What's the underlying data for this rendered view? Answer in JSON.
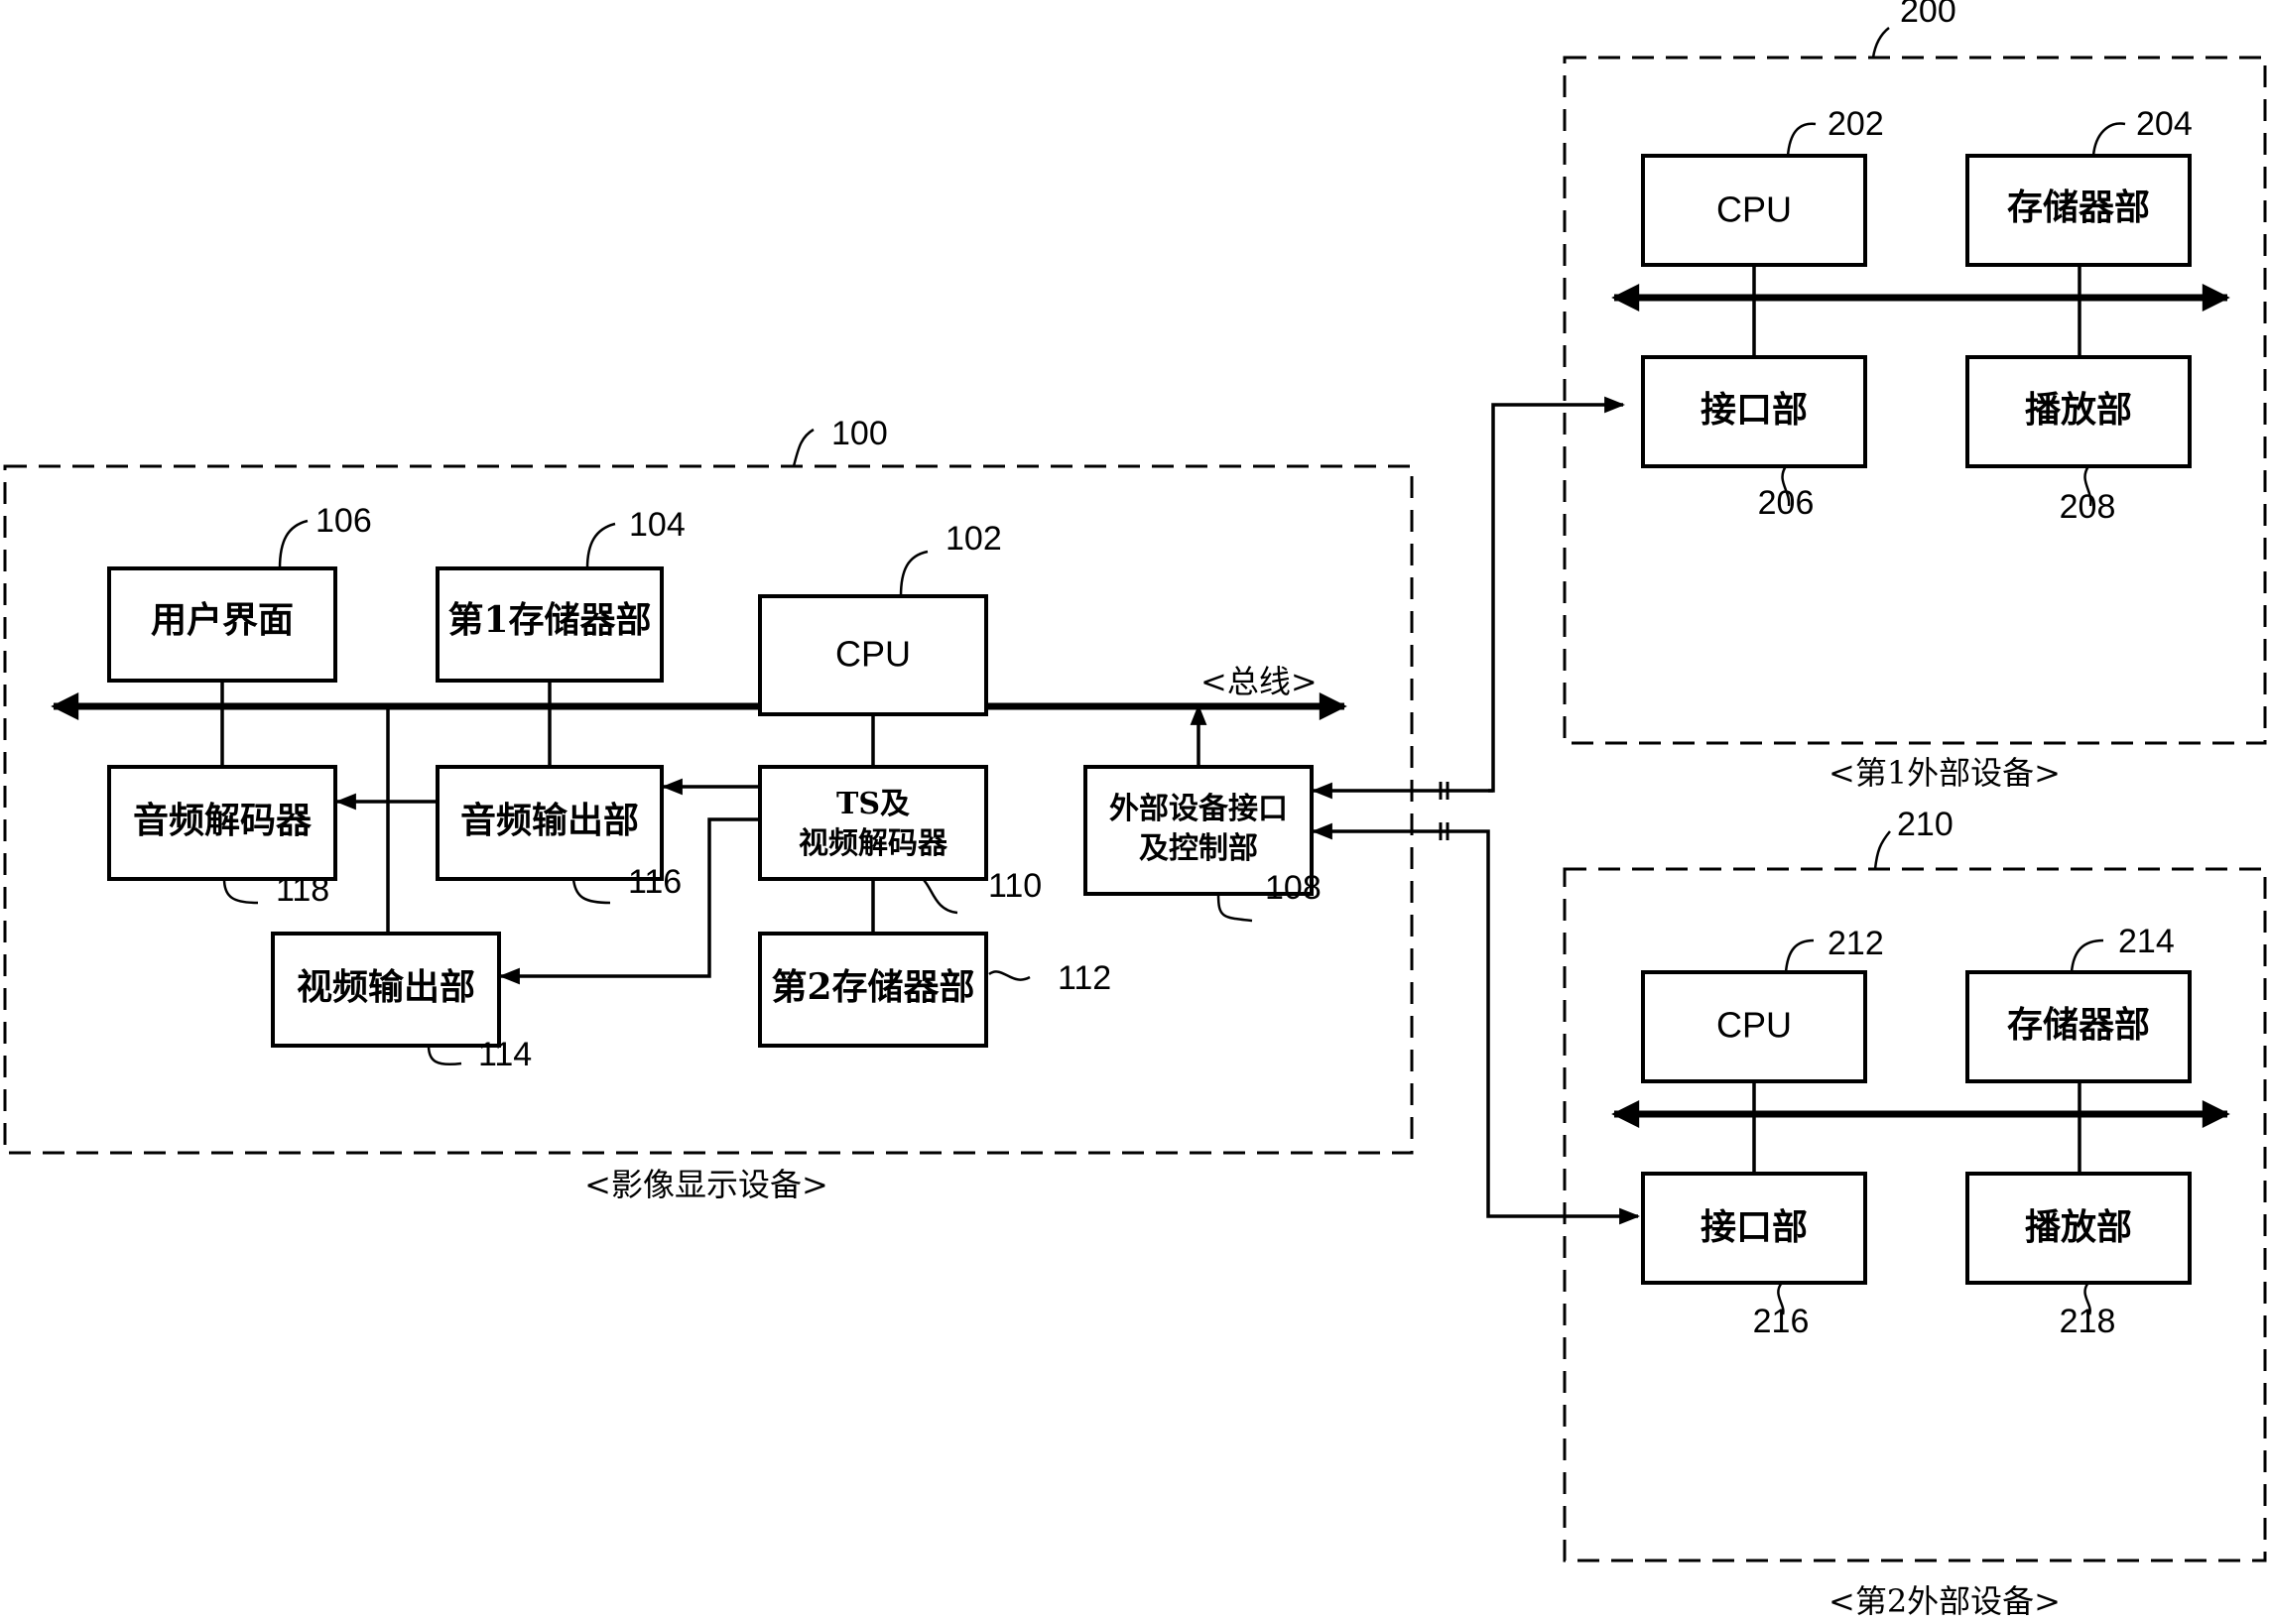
{
  "main_device": {
    "ref": "100",
    "caption": "<影像显示设备>",
    "bus_label": "<总线>",
    "blocks": {
      "user_interface": {
        "label": "用户界面",
        "ref": "106"
      },
      "first_storage": {
        "label": "第1存储器部",
        "ref": "104"
      },
      "cpu": {
        "label": "CPU",
        "ref": "102"
      },
      "audio_decoder": {
        "label": "音频解码器",
        "ref": "118"
      },
      "audio_output": {
        "label": "音频输出部",
        "ref": "116"
      },
      "ts_video_decoder": {
        "line1": "TS及",
        "line2": "视频解码器",
        "ref": "110"
      },
      "ext_interface": {
        "line1": "外部设备接口",
        "line2": "及控制部",
        "ref": "108"
      },
      "video_output": {
        "label": "视频输出部",
        "ref": "114"
      },
      "second_storage": {
        "label": "第2存储器部",
        "ref": "112"
      }
    }
  },
  "external_device_1": {
    "ref": "200",
    "caption": "<第1外部设备>",
    "blocks": {
      "cpu": {
        "label": "CPU",
        "ref": "202"
      },
      "storage": {
        "label": "存储器部",
        "ref": "204"
      },
      "interface": {
        "label": "接口部",
        "ref": "206"
      },
      "player": {
        "label": "播放部",
        "ref": "208"
      }
    }
  },
  "external_device_2": {
    "ref": "210",
    "caption": "<第2外部设备>",
    "blocks": {
      "cpu": {
        "label": "CPU",
        "ref": "212"
      },
      "storage": {
        "label": "存储器部",
        "ref": "214"
      },
      "interface": {
        "label": "接口部",
        "ref": "216"
      },
      "player": {
        "label": "播放部",
        "ref": "218"
      }
    }
  }
}
